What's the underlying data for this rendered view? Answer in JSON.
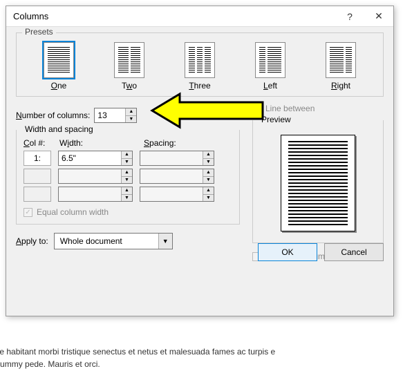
{
  "dialog": {
    "title": "Columns",
    "help": "?",
    "close": "✕"
  },
  "presets": {
    "legend": "Presets",
    "items": [
      {
        "key": "one",
        "label": "One",
        "accel": "O",
        "cols": [
          1
        ]
      },
      {
        "key": "two",
        "label": "Two",
        "accel": "w",
        "cols": [
          1,
          1
        ]
      },
      {
        "key": "three",
        "label": "Three",
        "accel": "T",
        "cols": [
          1,
          1,
          1
        ]
      },
      {
        "key": "left",
        "label": "Left",
        "accel": "L",
        "cols": [
          0.45,
          1
        ]
      },
      {
        "key": "right",
        "label": "Right",
        "accel": "R",
        "cols": [
          1,
          0.45
        ]
      }
    ],
    "selected": "one"
  },
  "numcols": {
    "label": "Number of columns:",
    "value": "13"
  },
  "line_between": {
    "label": "Line between",
    "checked": false,
    "enabled": false
  },
  "widthspacing": {
    "legend": "Width and spacing",
    "col_hdr": "Col #:",
    "width_hdr": "Width:",
    "spacing_hdr": "Spacing:",
    "rows": [
      {
        "col": "1:",
        "width": "6.5\"",
        "spacing": "",
        "enabled": true
      },
      {
        "col": "",
        "width": "",
        "spacing": "",
        "enabled": false
      },
      {
        "col": "",
        "width": "",
        "spacing": "",
        "enabled": false
      }
    ],
    "equal": {
      "label": "Equal column width",
      "checked": true,
      "enabled": false
    }
  },
  "preview": {
    "legend": "Preview"
  },
  "start_new": {
    "label": "Start new column",
    "checked": false,
    "enabled": false
  },
  "apply": {
    "label": "Apply to:",
    "value": "Whole document"
  },
  "buttons": {
    "ok": "OK",
    "cancel": "Cancel"
  },
  "background_text": {
    "bottom1": "sque habitant morbi tristique senectus et netus et malesuada fames ac turpis e",
    "bottom2": "nonummy pede. Mauris et orci."
  }
}
